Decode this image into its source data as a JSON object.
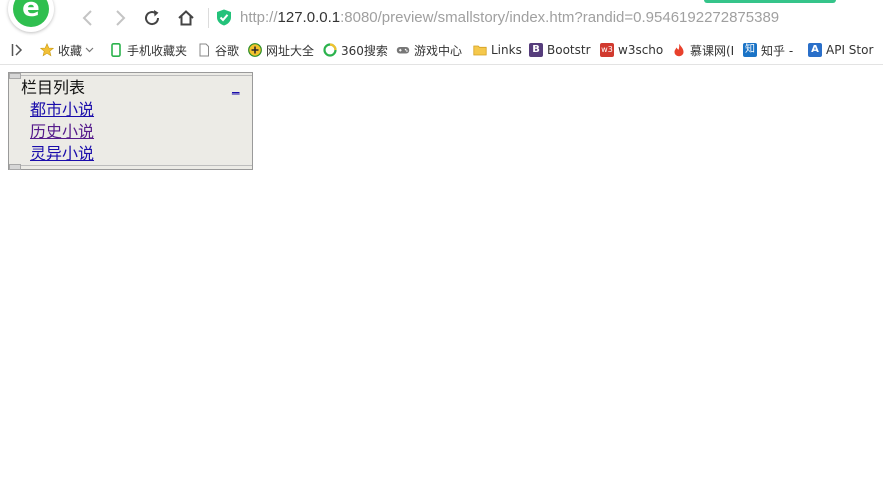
{
  "browser": {
    "url": {
      "prefix": "http://",
      "host": "127.0.0.1",
      "rest": ":8080/preview/smallstory/index.htm?randid=0.9546192272875389"
    },
    "logo_letter": "e"
  },
  "bookmarks": [
    {
      "label": "收藏",
      "icon": "star-icon"
    },
    {
      "label": "手机收藏夹",
      "icon": "phone-icon"
    },
    {
      "label": "谷歌",
      "icon": "page-icon"
    },
    {
      "label": "网址大全",
      "icon": "globe-icon"
    },
    {
      "label": "360搜索",
      "icon": "search-ring-icon"
    },
    {
      "label": "游戏中心",
      "icon": "gamepad-icon"
    },
    {
      "label": "Links",
      "icon": "folder-icon"
    },
    {
      "label": "Bootstr",
      "icon": "bootstrap-icon"
    },
    {
      "label": "w3scho",
      "icon": "w3-icon"
    },
    {
      "label": "慕课网(I",
      "icon": "flame-icon"
    },
    {
      "label": "知乎 -",
      "icon": "zhihu-icon"
    },
    {
      "label": "API Stor",
      "icon": "api-icon"
    }
  ],
  "panel": {
    "title": "栏目列表",
    "collapse_label": "_",
    "links": [
      {
        "label": "都市小说"
      },
      {
        "label": "历史小说"
      },
      {
        "label": "灵异小说"
      }
    ]
  }
}
